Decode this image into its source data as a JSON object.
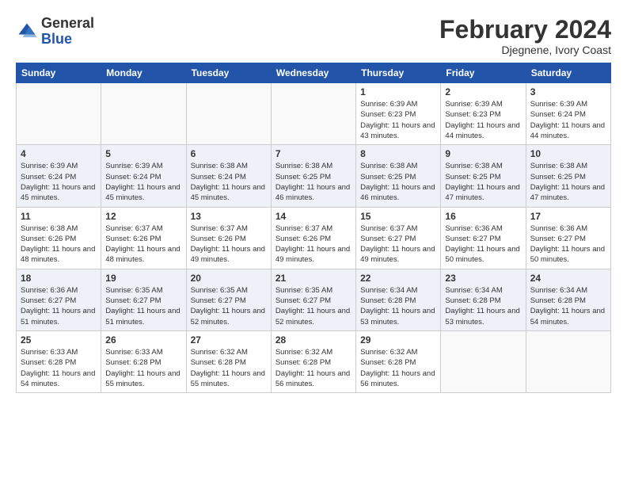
{
  "header": {
    "logo_general": "General",
    "logo_blue": "Blue",
    "month_title": "February 2024",
    "subtitle": "Djegnene, Ivory Coast"
  },
  "days_of_week": [
    "Sunday",
    "Monday",
    "Tuesday",
    "Wednesday",
    "Thursday",
    "Friday",
    "Saturday"
  ],
  "weeks": [
    [
      {
        "day": "",
        "info": ""
      },
      {
        "day": "",
        "info": ""
      },
      {
        "day": "",
        "info": ""
      },
      {
        "day": "",
        "info": ""
      },
      {
        "day": "1",
        "info": "Sunrise: 6:39 AM\nSunset: 6:23 PM\nDaylight: 11 hours and 43 minutes."
      },
      {
        "day": "2",
        "info": "Sunrise: 6:39 AM\nSunset: 6:23 PM\nDaylight: 11 hours and 44 minutes."
      },
      {
        "day": "3",
        "info": "Sunrise: 6:39 AM\nSunset: 6:24 PM\nDaylight: 11 hours and 44 minutes."
      }
    ],
    [
      {
        "day": "4",
        "info": "Sunrise: 6:39 AM\nSunset: 6:24 PM\nDaylight: 11 hours and 45 minutes."
      },
      {
        "day": "5",
        "info": "Sunrise: 6:39 AM\nSunset: 6:24 PM\nDaylight: 11 hours and 45 minutes."
      },
      {
        "day": "6",
        "info": "Sunrise: 6:38 AM\nSunset: 6:24 PM\nDaylight: 11 hours and 45 minutes."
      },
      {
        "day": "7",
        "info": "Sunrise: 6:38 AM\nSunset: 6:25 PM\nDaylight: 11 hours and 46 minutes."
      },
      {
        "day": "8",
        "info": "Sunrise: 6:38 AM\nSunset: 6:25 PM\nDaylight: 11 hours and 46 minutes."
      },
      {
        "day": "9",
        "info": "Sunrise: 6:38 AM\nSunset: 6:25 PM\nDaylight: 11 hours and 47 minutes."
      },
      {
        "day": "10",
        "info": "Sunrise: 6:38 AM\nSunset: 6:25 PM\nDaylight: 11 hours and 47 minutes."
      }
    ],
    [
      {
        "day": "11",
        "info": "Sunrise: 6:38 AM\nSunset: 6:26 PM\nDaylight: 11 hours and 48 minutes."
      },
      {
        "day": "12",
        "info": "Sunrise: 6:37 AM\nSunset: 6:26 PM\nDaylight: 11 hours and 48 minutes."
      },
      {
        "day": "13",
        "info": "Sunrise: 6:37 AM\nSunset: 6:26 PM\nDaylight: 11 hours and 49 minutes."
      },
      {
        "day": "14",
        "info": "Sunrise: 6:37 AM\nSunset: 6:26 PM\nDaylight: 11 hours and 49 minutes."
      },
      {
        "day": "15",
        "info": "Sunrise: 6:37 AM\nSunset: 6:27 PM\nDaylight: 11 hours and 49 minutes."
      },
      {
        "day": "16",
        "info": "Sunrise: 6:36 AM\nSunset: 6:27 PM\nDaylight: 11 hours and 50 minutes."
      },
      {
        "day": "17",
        "info": "Sunrise: 6:36 AM\nSunset: 6:27 PM\nDaylight: 11 hours and 50 minutes."
      }
    ],
    [
      {
        "day": "18",
        "info": "Sunrise: 6:36 AM\nSunset: 6:27 PM\nDaylight: 11 hours and 51 minutes."
      },
      {
        "day": "19",
        "info": "Sunrise: 6:35 AM\nSunset: 6:27 PM\nDaylight: 11 hours and 51 minutes."
      },
      {
        "day": "20",
        "info": "Sunrise: 6:35 AM\nSunset: 6:27 PM\nDaylight: 11 hours and 52 minutes."
      },
      {
        "day": "21",
        "info": "Sunrise: 6:35 AM\nSunset: 6:27 PM\nDaylight: 11 hours and 52 minutes."
      },
      {
        "day": "22",
        "info": "Sunrise: 6:34 AM\nSunset: 6:28 PM\nDaylight: 11 hours and 53 minutes."
      },
      {
        "day": "23",
        "info": "Sunrise: 6:34 AM\nSunset: 6:28 PM\nDaylight: 11 hours and 53 minutes."
      },
      {
        "day": "24",
        "info": "Sunrise: 6:34 AM\nSunset: 6:28 PM\nDaylight: 11 hours and 54 minutes."
      }
    ],
    [
      {
        "day": "25",
        "info": "Sunrise: 6:33 AM\nSunset: 6:28 PM\nDaylight: 11 hours and 54 minutes."
      },
      {
        "day": "26",
        "info": "Sunrise: 6:33 AM\nSunset: 6:28 PM\nDaylight: 11 hours and 55 minutes."
      },
      {
        "day": "27",
        "info": "Sunrise: 6:32 AM\nSunset: 6:28 PM\nDaylight: 11 hours and 55 minutes."
      },
      {
        "day": "28",
        "info": "Sunrise: 6:32 AM\nSunset: 6:28 PM\nDaylight: 11 hours and 56 minutes."
      },
      {
        "day": "29",
        "info": "Sunrise: 6:32 AM\nSunset: 6:28 PM\nDaylight: 11 hours and 56 minutes."
      },
      {
        "day": "",
        "info": ""
      },
      {
        "day": "",
        "info": ""
      }
    ]
  ]
}
